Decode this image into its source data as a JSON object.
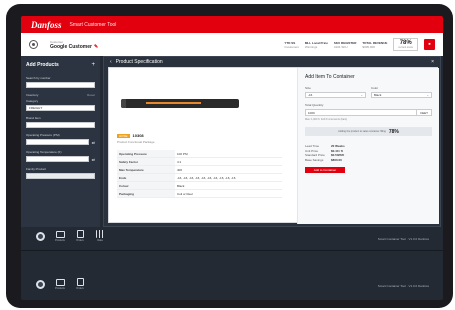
{
  "header": {
    "brand": "Danfoss",
    "tool_title": "Smart Customer Tool",
    "customer_label": "Customer",
    "customer_name": "Google Customer"
  },
  "stats": [
    {
      "label": "YTD SS",
      "value": "Customers"
    },
    {
      "label": "MLL Local Price",
      "value": "Winnings"
    },
    {
      "label": "SKU REGISTER",
      "value": "4101 SKU"
    },
    {
      "label": "TOTAL REVENUE",
      "value": "$305,000"
    }
  ],
  "score": {
    "value": "78%",
    "label": "current score"
  },
  "sidebar": {
    "title": "Add Products",
    "fields": {
      "search_label": "Search by number",
      "search_value": "",
      "inventory_label": "Inventory",
      "reset": "Reset",
      "category_label": "Category",
      "category_value": "FREIGHT",
      "brand_label": "Brand Item",
      "brand_value": "",
      "pressure_label": "Operating Pressure (PSI)",
      "temp_label": "Operating Temperature (F)",
      "family_label": "Family Product",
      "family_value": ""
    }
  },
  "modal": {
    "title": "Product Specification",
    "product": {
      "badge": "HOSE",
      "code": "10308",
      "description": "Product Functional Package"
    },
    "specs": [
      {
        "k": "Operating Pressure",
        "v": "100 PSI"
      },
      {
        "k": "Safety Factor",
        "v": "4:1"
      },
      {
        "k": "Max Temperature",
        "v": "400"
      },
      {
        "k": "Ends",
        "v": "-16, -16, -16, -16, -16, -16, -16, -16, -16, -16"
      },
      {
        "k": "Colour",
        "v": "Black"
      },
      {
        "k": "Packaging",
        "v": "Coil or Reel"
      }
    ],
    "add": {
      "title": "Add Item To Container",
      "size_label": "Size",
      "size_value": "-16",
      "color_label": "Color",
      "color_value": "Black",
      "qty_label": "Total Quantity",
      "qty_value": "1000",
      "qty_unit": "FEET",
      "help": "Max: 1,000 ft. Full ft increments (bars)",
      "bar_text": "Adding the product to sales container filling",
      "bar_pct": "78%",
      "rows": [
        {
          "k": "Lead Time",
          "v": "20 Weeks"
        },
        {
          "k": "Unit Price",
          "v": "$0.40 / ft"
        },
        {
          "k": "Standard Price",
          "v": "$0.50/ft/ft"
        },
        {
          "k": "Base Savings",
          "v": "$800.00"
        }
      ],
      "button": "Add to Container"
    }
  },
  "bottom_bars": [
    {
      "icons": [
        "Settings",
        "Products",
        "Orders",
        "Data"
      ],
      "footer": "Smart Container Tool · V1.0.0 Danfoss"
    },
    {
      "icons": [
        "Settings",
        "Products",
        "Orders"
      ],
      "footer": "Smart Container Tool · V1.0.0 Danfoss"
    }
  ],
  "colors": {
    "accent": "#e2000f",
    "sidebar": "#2b3440",
    "hose_stripe": "#e8882a"
  }
}
